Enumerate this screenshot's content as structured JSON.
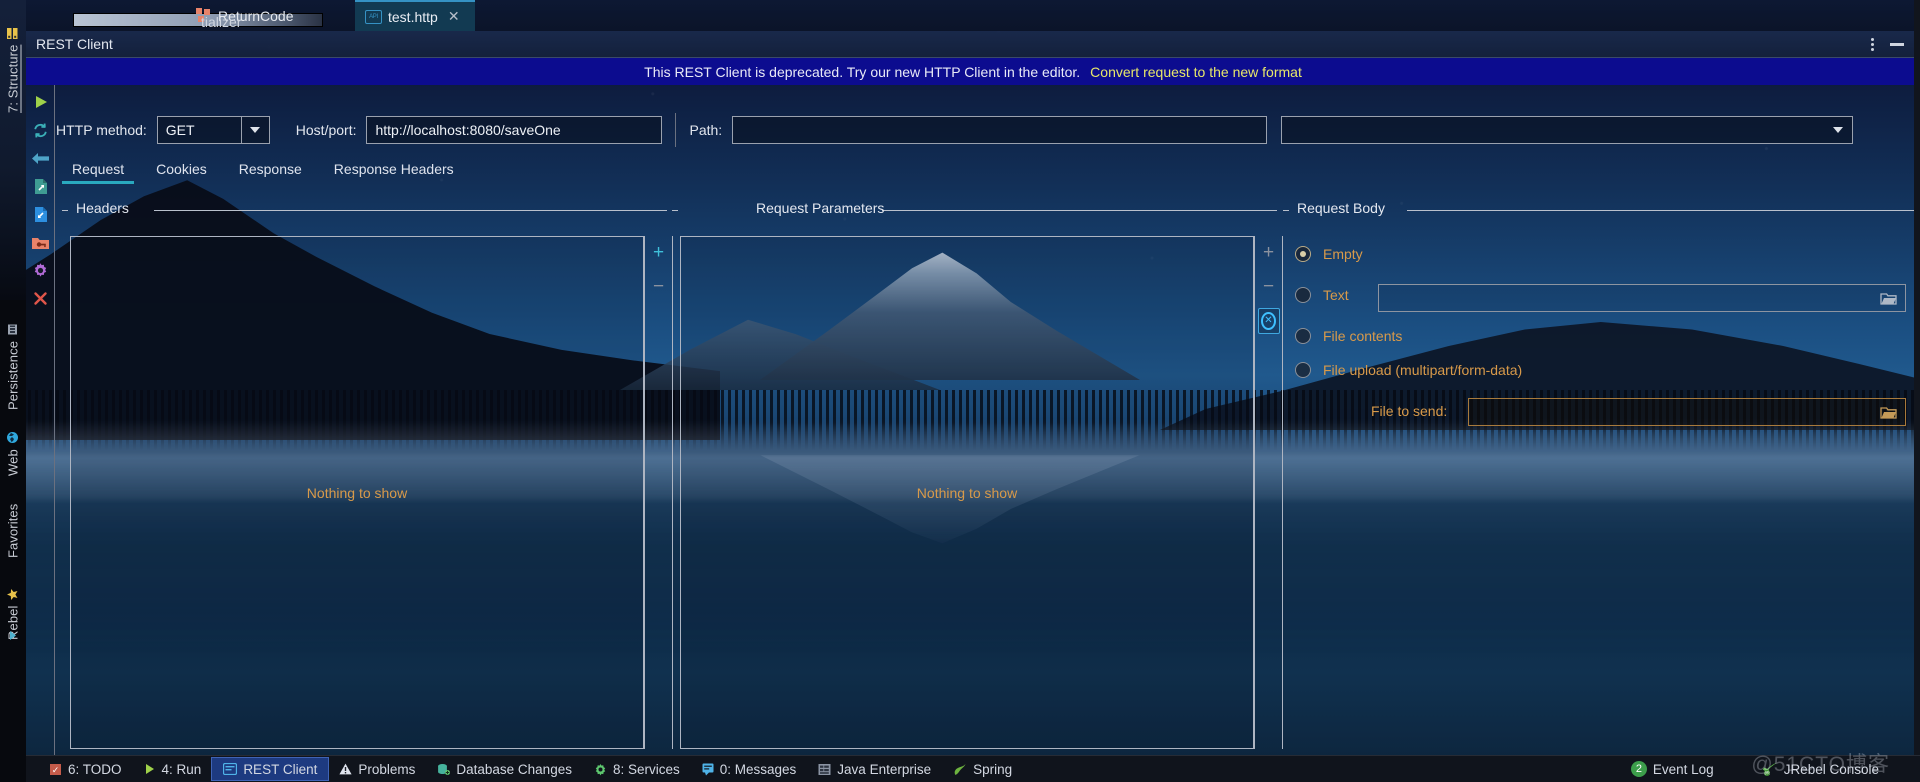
{
  "editor_tabs": {
    "return_code_tab": "ReturnCode",
    "initializer_text": "tializer",
    "http_tab": "test.http",
    "close_glyph": "✕",
    "api_icon_text": "API"
  },
  "tool_window": {
    "title": "REST Client",
    "options_icon": "more-options-icon",
    "minimize_icon": "minimize-icon"
  },
  "banner": {
    "message": "This REST Client is deprecated. Try our new HTTP Client in the editor.",
    "link": "Convert request to the new format",
    "bg_color": "#0c0c8f",
    "link_color": "#e8e86a"
  },
  "action_rail": [
    {
      "name": "run-icon",
      "label": "Run"
    },
    {
      "name": "refresh-icon",
      "label": "Refresh"
    },
    {
      "name": "back-arrow-icon",
      "label": "Back"
    },
    {
      "name": "export-file-icon",
      "label": "Export Request"
    },
    {
      "name": "import-file-icon",
      "label": "Import Request"
    },
    {
      "name": "folder-key-icon",
      "label": "Generate Request"
    },
    {
      "name": "gear-icon",
      "label": "Settings"
    },
    {
      "name": "close-x-icon",
      "label": "Close"
    }
  ],
  "form": {
    "http_method_label": "HTTP method:",
    "http_method_value": "GET",
    "host_port_label": "Host/port:",
    "host_port_value": "http://localhost:8080/saveOne",
    "path_label": "Path:",
    "path_value": "",
    "extra_combo_value": ""
  },
  "tabs": [
    {
      "label": "Request",
      "active": true
    },
    {
      "label": "Cookies",
      "active": false
    },
    {
      "label": "Response",
      "active": false
    },
    {
      "label": "Response Headers",
      "active": false
    }
  ],
  "panels": {
    "headers": {
      "title": "Headers",
      "empty_text": "Nothing to show",
      "add_label": "+",
      "remove_label": "−"
    },
    "request_parameters": {
      "title": "Request Parameters",
      "empty_text": "Nothing to show",
      "add_label": "+",
      "remove_label": "−",
      "close_label": "✕"
    },
    "request_body": {
      "title": "Request Body",
      "options": [
        {
          "label": "Empty",
          "selected": true
        },
        {
          "label": "Text",
          "selected": false
        },
        {
          "label": "File contents",
          "selected": false
        },
        {
          "label": "File upload (multipart/form-data)",
          "selected": false
        }
      ],
      "text_value": "",
      "file_to_send_label": "File to send:",
      "file_to_send_value": "",
      "browse_icon": "folder-icon",
      "label_color": "#d89a4a"
    }
  },
  "left_rail": {
    "structure": "7: Structure",
    "persistence": "Persistence",
    "web": "Web",
    "favorites": "Favorites",
    "jrebel": "Rebel"
  },
  "status_bar": {
    "items": [
      {
        "label": "6: TODO",
        "icon": "todo-icon",
        "selected": false
      },
      {
        "label": "4: Run",
        "icon": "run-icon",
        "selected": false
      },
      {
        "label": "REST Client",
        "icon": "rest-client-icon",
        "selected": true
      },
      {
        "label": "Problems",
        "icon": "warning-icon",
        "selected": false
      },
      {
        "label": "Database Changes",
        "icon": "database-icon",
        "selected": false
      },
      {
        "label": "8: Services",
        "icon": "services-icon",
        "selected": false
      },
      {
        "label": "0: Messages",
        "icon": "messages-icon",
        "selected": false
      },
      {
        "label": "Java Enterprise",
        "icon": "java-enterprise-icon",
        "selected": false
      },
      {
        "label": "Spring",
        "icon": "spring-icon",
        "selected": false
      }
    ],
    "right": {
      "event_log_label": "Event Log",
      "event_log_count": "2",
      "jrebel_label": "JRebel Console",
      "jrebel_icon": "jrebel-icon"
    }
  },
  "watermark": "@51CTO博客"
}
